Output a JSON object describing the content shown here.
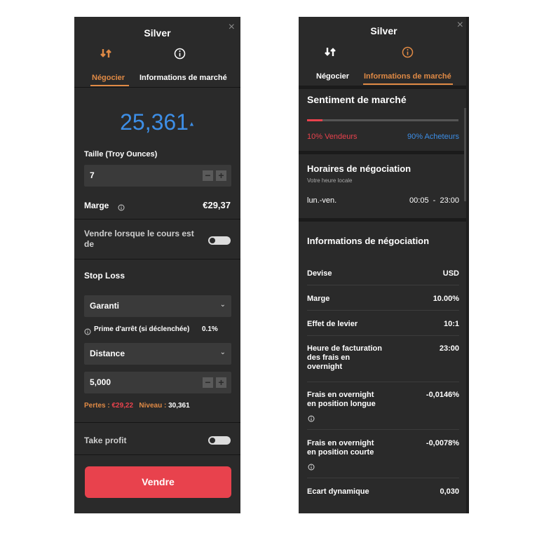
{
  "left": {
    "title": "Silver",
    "close": "×",
    "tab_trade": "Négocier",
    "tab_info": "Informations de marché",
    "price": "25,361",
    "price_arrow": "▲",
    "size_label": "Taille (Troy Ounces)",
    "size_value": "7",
    "minus": "−",
    "plus": "+",
    "margin_label": "Marge",
    "margin_value": "€29,37",
    "sell_when_label": "Vendre lorsque le cours est de",
    "stop_loss_label": "Stop Loss",
    "stop_type": "Garanti",
    "premium_label": "Prime d'arrêt (si déclenchée)",
    "premium_value": "0.1%",
    "distance_type": "Distance",
    "distance_value": "5,000",
    "losses_label": "Pertes :",
    "losses_value": "€29,22",
    "level_label": "Niveau :",
    "level_value": "30,361",
    "take_profit_label": "Take profit",
    "sell_button": "Vendre"
  },
  "right": {
    "title": "Silver",
    "close": "×",
    "tab_trade": "Négocier",
    "tab_info": "Informations de marché",
    "sentiment_title": "Sentiment de marché",
    "sellers": "10% Vendeurs",
    "buyers": "90% Acheteurs",
    "sellers_fraction": 0.1,
    "hours_title": "Horaires de négociation",
    "hours_sub": "Votre heure locale",
    "hours_days": "lun.-ven.",
    "hours_time": "00:05  -  23:00",
    "info_title": "Informations de négociation",
    "rows": [
      {
        "label": "Devise",
        "value": "USD"
      },
      {
        "label": "Marge",
        "value": "10.00%"
      },
      {
        "label": "Effet de levier",
        "value": "10:1"
      },
      {
        "label": "Heure de facturation des frais en overnight",
        "value": "23:00"
      },
      {
        "label": "Frais en overnight en position longue",
        "value": "-0,0146%"
      },
      {
        "label": "Frais en overnight en position courte",
        "value": "-0,0078%"
      },
      {
        "label": "Ecart dynamique",
        "value": "0,030"
      }
    ]
  },
  "colors": {
    "accent": "#e08a45",
    "sell": "#e8424d",
    "buy": "#3d8ee6",
    "panel": "#2a2a2a"
  }
}
